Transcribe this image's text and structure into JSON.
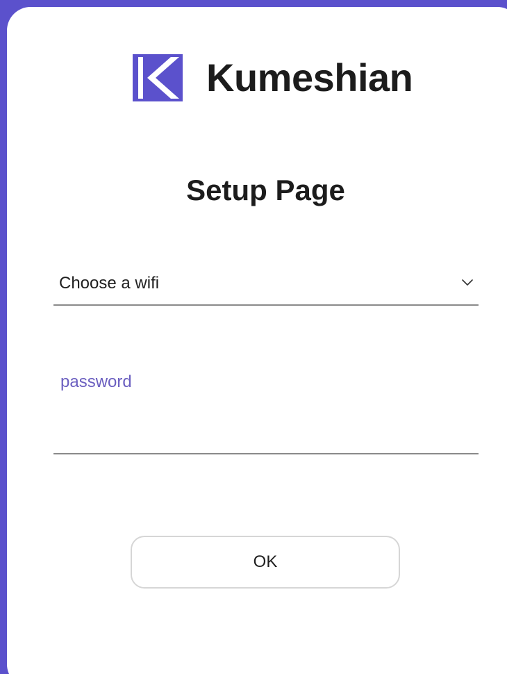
{
  "brand": {
    "name": "Kumeshian",
    "logo_icon": "k-chevron-logo-icon",
    "accent_color": "#5b51cc"
  },
  "page": {
    "title": "Setup Page"
  },
  "wifi_select": {
    "selected": "Choose a wifi",
    "icon": "chevron-down-icon"
  },
  "password": {
    "label": "password",
    "value": "",
    "label_color": "#6b5fc0"
  },
  "actions": {
    "ok_label": "OK"
  }
}
